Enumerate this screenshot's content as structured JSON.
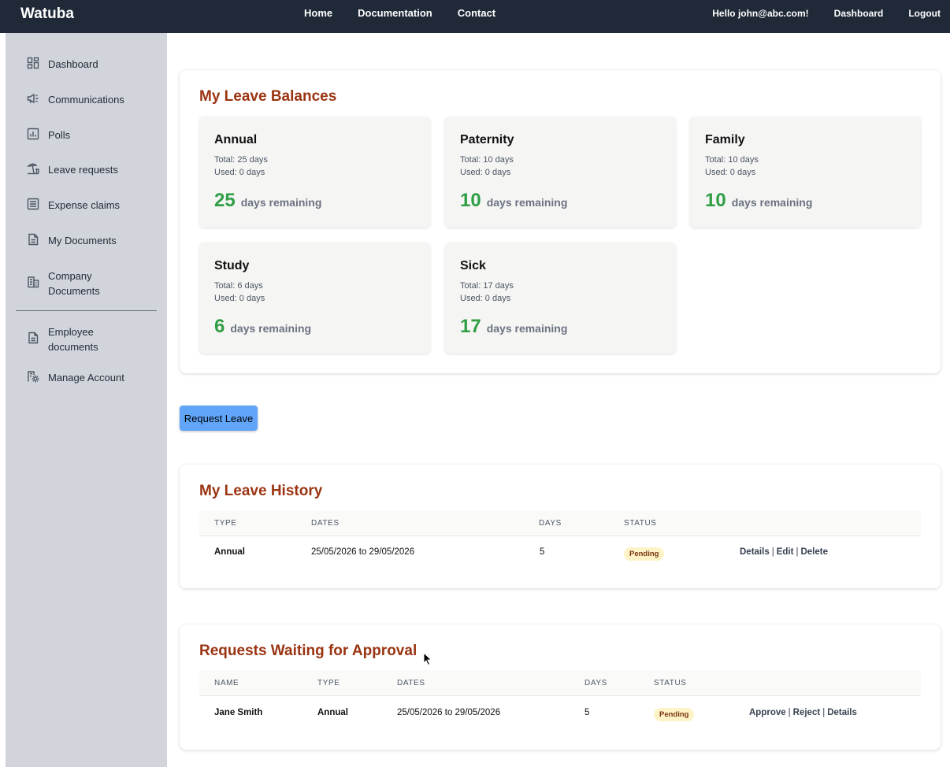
{
  "topbar": {
    "brand": "Watuba",
    "nav": [
      "Home",
      "Documentation",
      "Contact"
    ],
    "greeting": "Hello john@abc.com!",
    "dashboard": "Dashboard",
    "logout": "Logout"
  },
  "sidebar": {
    "items": [
      {
        "label": "Dashboard",
        "icon": "dashboard-icon"
      },
      {
        "label": "Communications",
        "icon": "megaphone-icon"
      },
      {
        "label": "Polls",
        "icon": "chart-icon"
      },
      {
        "label": "Leave requests",
        "icon": "beach-icon"
      },
      {
        "label": "Expense claims",
        "icon": "list-icon"
      },
      {
        "label": "My Documents",
        "icon": "document-icon"
      },
      {
        "label": "Company Documents",
        "icon": "building-icon"
      },
      {
        "label": "Employee documents",
        "icon": "document-icon"
      },
      {
        "label": "Manage Account",
        "icon": "settings-icon"
      }
    ]
  },
  "balances": {
    "title": "My Leave Balances",
    "cards": [
      {
        "type": "Annual",
        "total": "Total: 25 days",
        "used": "Used: 0 days",
        "remaining": "25",
        "remaining_label": "days remaining"
      },
      {
        "type": "Paternity",
        "total": "Total: 10 days",
        "used": "Used: 0 days",
        "remaining": "10",
        "remaining_label": "days remaining"
      },
      {
        "type": "Family",
        "total": "Total: 10 days",
        "used": "Used: 0 days",
        "remaining": "10",
        "remaining_label": "days remaining"
      },
      {
        "type": "Study",
        "total": "Total: 6 days",
        "used": "Used: 0 days",
        "remaining": "6",
        "remaining_label": "days remaining"
      },
      {
        "type": "Sick",
        "total": "Total: 17 days",
        "used": "Used: 0 days",
        "remaining": "17",
        "remaining_label": "days remaining"
      }
    ]
  },
  "request_button": "Request Leave",
  "history": {
    "title": "My Leave History",
    "headers": [
      "TYPE",
      "DATES",
      "DAYS",
      "STATUS"
    ],
    "rows": [
      {
        "type": "Annual",
        "dates": "25/05/2026 to 29/05/2026",
        "days": "5",
        "status": "Pending",
        "actions": [
          "Details",
          "Edit",
          "Delete"
        ]
      }
    ]
  },
  "approvals": {
    "title": "Requests Waiting for Approval",
    "headers": [
      "NAME",
      "TYPE",
      "DATES",
      "DAYS",
      "STATUS"
    ],
    "rows": [
      {
        "name": "Jane Smith",
        "type": "Annual",
        "dates": "25/05/2026 to 29/05/2026",
        "days": "5",
        "status": "Pending",
        "actions": [
          "Approve",
          "Reject",
          "Details"
        ]
      }
    ]
  },
  "colors": {
    "topbar": "#1f2937",
    "sidebar": "#d1d5db",
    "heading": "#9a3412",
    "remaining": "#2f9e44",
    "button": "#60a5fa",
    "badge_bg": "#fef3c7"
  }
}
